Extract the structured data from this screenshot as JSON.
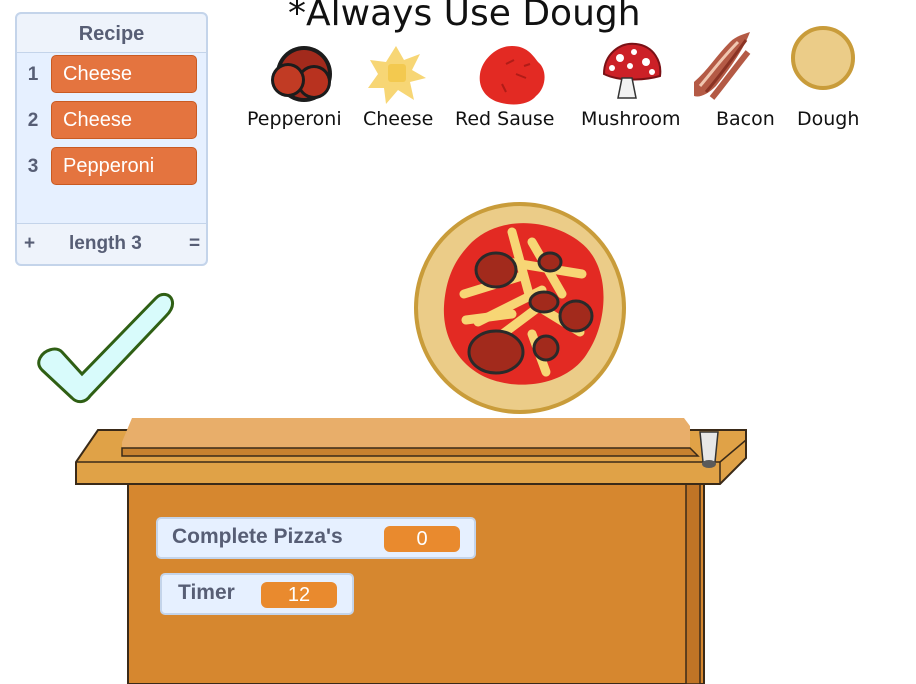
{
  "title": "*Always Use Dough",
  "recipe_list": {
    "title": "Recipe",
    "items": [
      {
        "index": "1",
        "value": "Cheese"
      },
      {
        "index": "2",
        "value": "Cheese"
      },
      {
        "index": "3",
        "value": "Pepperoni"
      }
    ],
    "add_label": "+",
    "length_label": "length 3",
    "resize_label": "="
  },
  "ingredients": [
    {
      "name": "Pepperoni",
      "icon": "pepperoni-icon"
    },
    {
      "name": "Cheese",
      "icon": "cheese-icon"
    },
    {
      "name": "Red Sause",
      "icon": "red-sauce-icon"
    },
    {
      "name": "Mushroom",
      "icon": "mushroom-icon"
    },
    {
      "name": "Bacon",
      "icon": "bacon-icon"
    },
    {
      "name": "Dough",
      "icon": "dough-icon"
    }
  ],
  "monitors": {
    "complete_label": "Complete Pizza's",
    "complete_value": "0",
    "timer_label": "Timer",
    "timer_value": "12"
  },
  "colors": {
    "counter": "#d6872f",
    "list_item": "#e4743f",
    "monitor_value": "#e98a2e",
    "checkmark_fill": "#d8fbfb",
    "checkmark_stroke": "#2f5f14"
  },
  "icons": [
    "check-icon",
    "pizza",
    "counter",
    "pizza-paddle",
    "glass-icon"
  ]
}
